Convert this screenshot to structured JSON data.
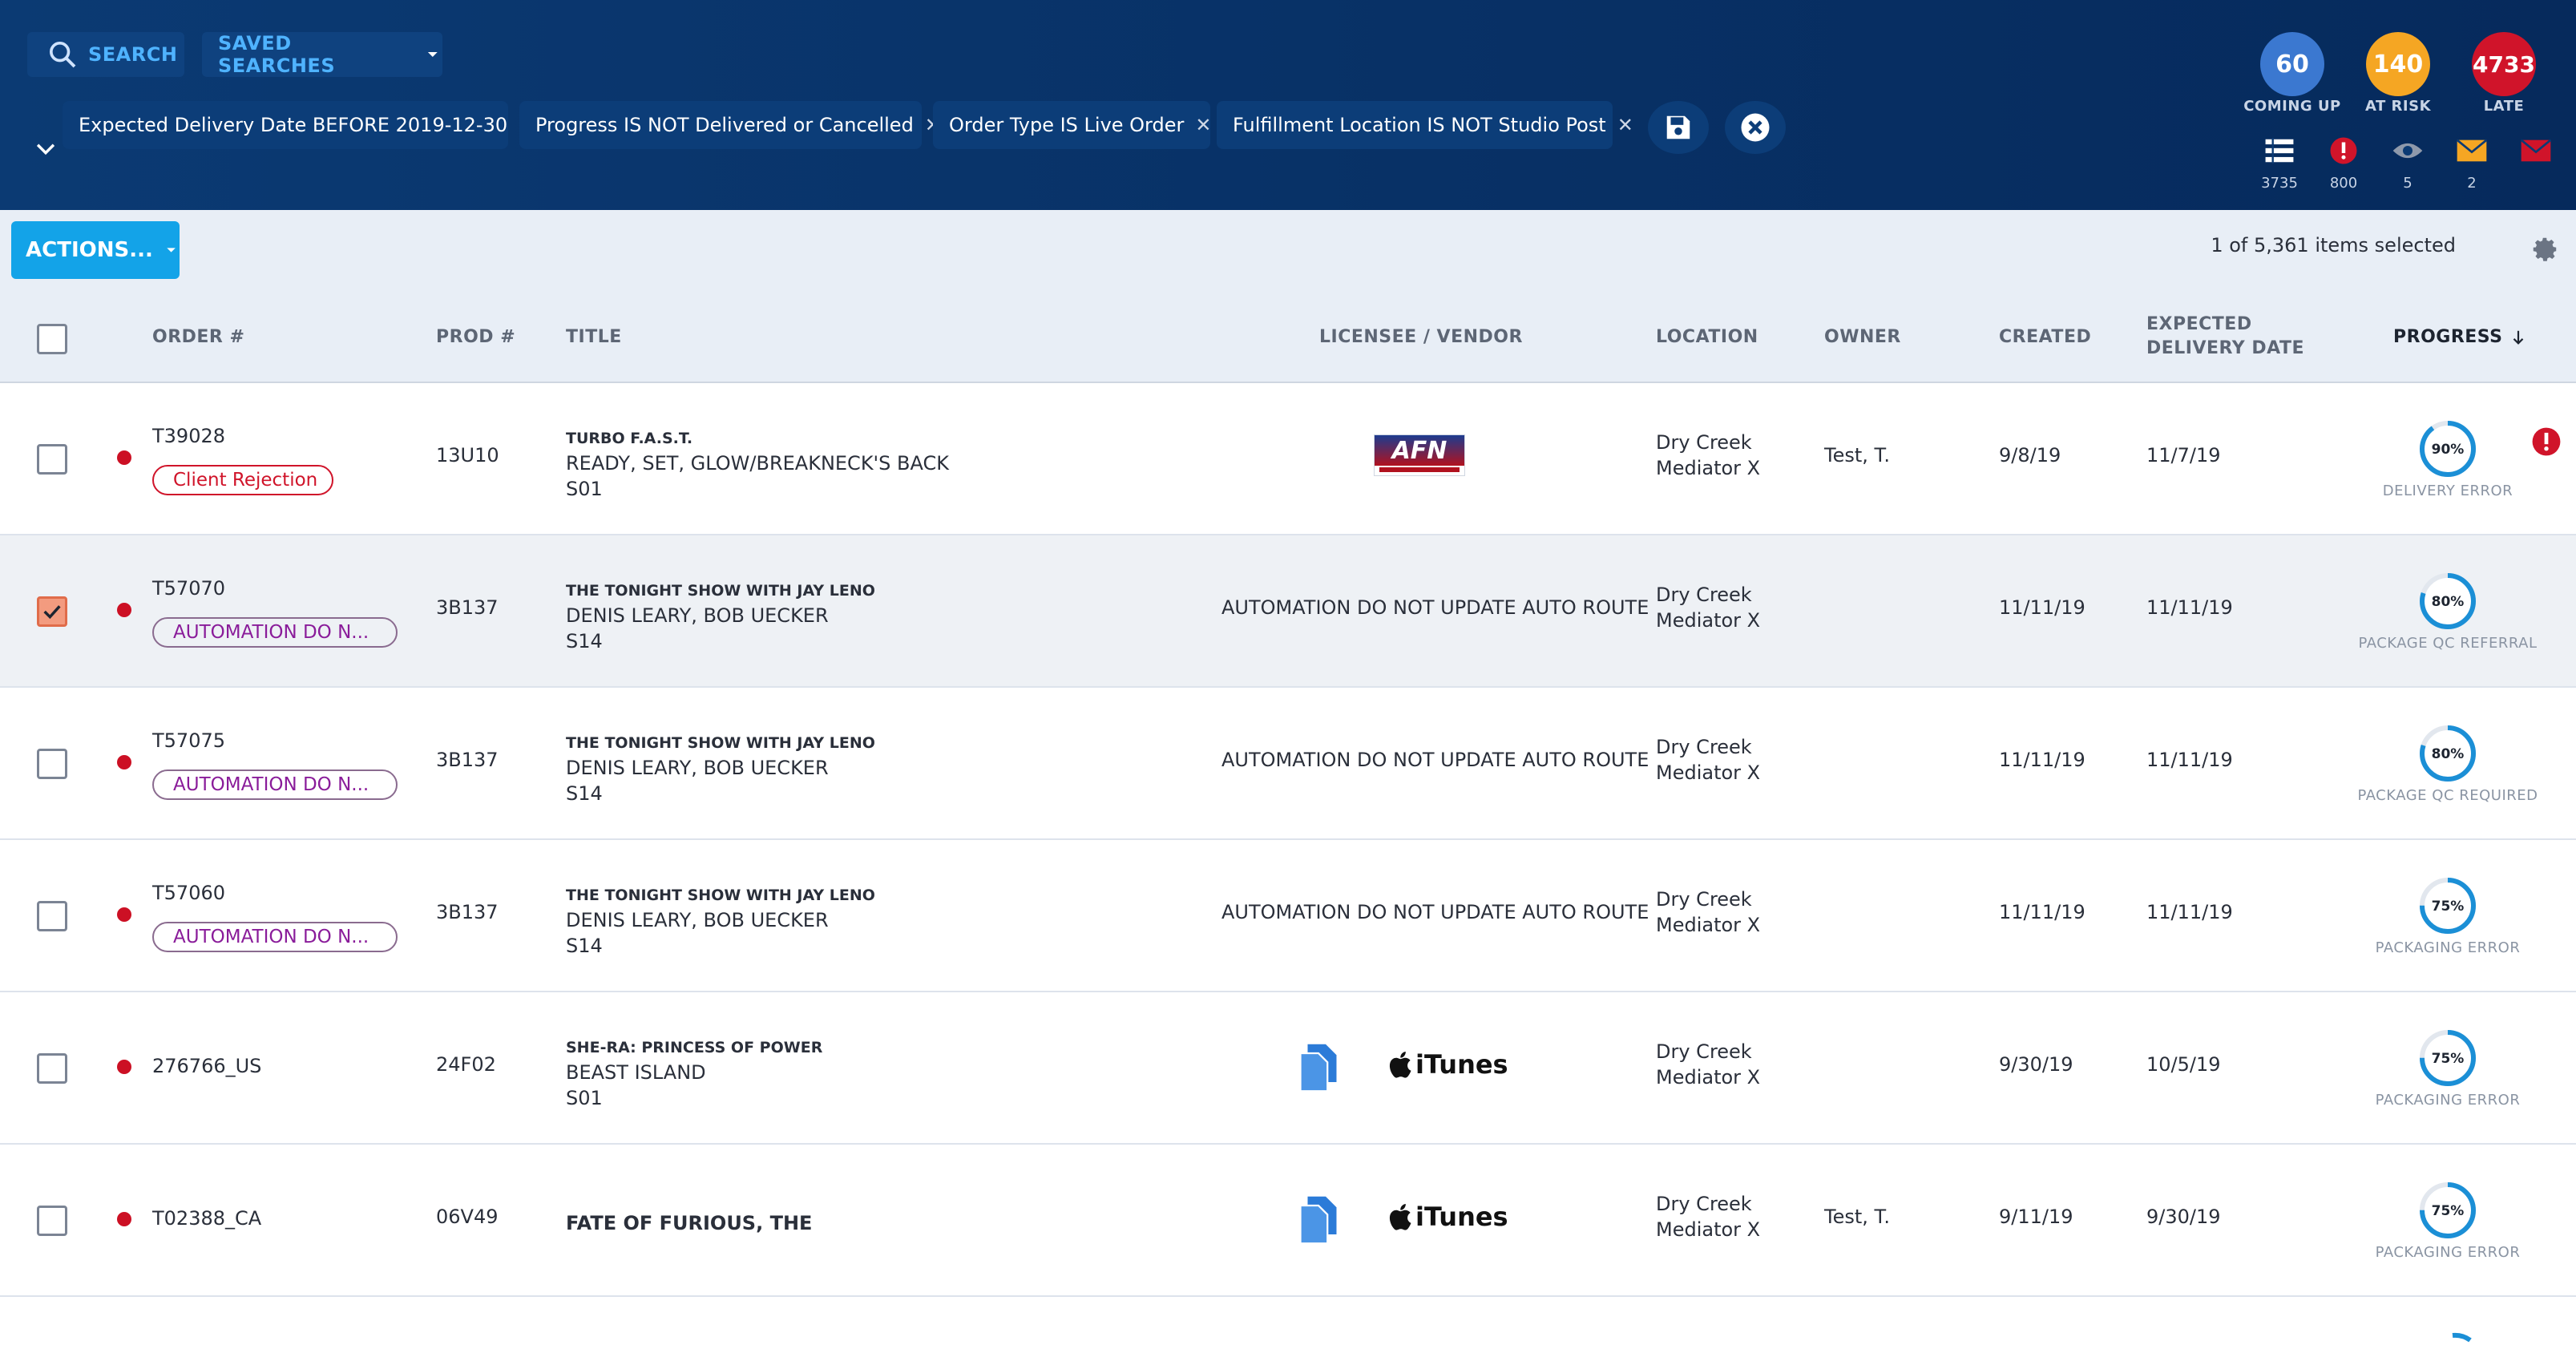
{
  "header": {
    "search_label": "SEARCH",
    "saved_searches_label": "SAVED SEARCHES",
    "filters": [
      {
        "label": "Expected Delivery Date BEFORE 2019-12-30"
      },
      {
        "label": "Progress IS NOT Delivered or Cancelled"
      },
      {
        "label": "Order Type IS Live Order"
      },
      {
        "label": "Fulfillment Location IS NOT Studio Post"
      }
    ],
    "stats": [
      {
        "value": "60",
        "label": "COMING UP",
        "color": "#3b78d0"
      },
      {
        "value": "140",
        "label": "AT RISK",
        "color": "#f5a623"
      },
      {
        "value": "4733",
        "label": "LATE",
        "color": "#d0142a"
      }
    ],
    "mini_counts": [
      {
        "icon": "list-icon",
        "count": "3735"
      },
      {
        "icon": "alert-icon",
        "count": "800"
      },
      {
        "icon": "eye-icon",
        "count": "5"
      },
      {
        "icon": "envelope-icon",
        "count": "2"
      },
      {
        "icon": "envelope-red-icon",
        "count": ""
      }
    ]
  },
  "toolbar": {
    "actions_label": "ACTIONS...",
    "selected_text": "1 of 5,361 items selected"
  },
  "columns": {
    "order": "ORDER #",
    "prod": "PROD #",
    "title": "TITLE",
    "licensee": "LICENSEE / VENDOR",
    "location": "LOCATION",
    "owner": "OWNER",
    "created": "CREATED",
    "expected_1": "EXPECTED",
    "expected_2": "DELIVERY DATE",
    "progress": "PROGRESS"
  },
  "rows": [
    {
      "order": "T39028",
      "badge": "Client Rejection",
      "badge_type": "red",
      "prod": "13U10",
      "title1": "TURBO F.A.S.T.",
      "title2": "READY, SET, GLOW/BREAKNECK'S BACK",
      "title3": "S01",
      "licensee": "",
      "licensee_logo": "AFN",
      "location1": "Dry Creek",
      "location2": "Mediator X",
      "owner": "Test, T.",
      "created": "9/8/19",
      "expected": "11/7/19",
      "progress_pct": 90,
      "progress_label": "DELIVERY ERROR",
      "alert": true,
      "checked": false
    },
    {
      "order": "T57070",
      "badge": "AUTOMATION DO N...",
      "badge_type": "purple",
      "prod": "3B137",
      "title1": "THE TONIGHT SHOW WITH JAY LENO",
      "title2": "DENIS LEARY, BOB UECKER",
      "title3": "S14",
      "licensee": "AUTOMATION DO NOT UPDATE AUTO ROUTE",
      "licensee_logo": "",
      "location1": "Dry Creek",
      "location2": "Mediator X",
      "owner": "",
      "created": "11/11/19",
      "expected": "11/11/19",
      "progress_pct": 80,
      "progress_label": "PACKAGE QC REFERRAL",
      "alert": false,
      "checked": true
    },
    {
      "order": "T57075",
      "badge": "AUTOMATION DO N...",
      "badge_type": "purple",
      "prod": "3B137",
      "title1": "THE TONIGHT SHOW WITH JAY LENO",
      "title2": "DENIS LEARY, BOB UECKER",
      "title3": "S14",
      "licensee": "AUTOMATION DO NOT UPDATE AUTO ROUTE",
      "licensee_logo": "",
      "location1": "Dry Creek",
      "location2": "Mediator X",
      "owner": "",
      "created": "11/11/19",
      "expected": "11/11/19",
      "progress_pct": 80,
      "progress_label": "PACKAGE QC REQUIRED",
      "alert": false,
      "checked": false
    },
    {
      "order": "T57060",
      "badge": "AUTOMATION DO N...",
      "badge_type": "purple",
      "prod": "3B137",
      "title1": "THE TONIGHT SHOW WITH JAY LENO",
      "title2": "DENIS LEARY, BOB UECKER",
      "title3": "S14",
      "licensee": "AUTOMATION DO NOT UPDATE AUTO ROUTE",
      "licensee_logo": "",
      "location1": "Dry Creek",
      "location2": "Mediator X",
      "owner": "",
      "created": "11/11/19",
      "expected": "11/11/19",
      "progress_pct": 75,
      "progress_label": "PACKAGING ERROR",
      "alert": false,
      "checked": false
    },
    {
      "order": "276766_US",
      "badge": "",
      "badge_type": "",
      "prod": "24F02",
      "title1": "SHE-RA: PRINCESS OF POWER",
      "title2": "BEAST ISLAND",
      "title3": "S01",
      "licensee": "",
      "licensee_logo": "iTunes",
      "location1": "Dry Creek",
      "location2": "Mediator X",
      "owner": "",
      "created": "9/30/19",
      "expected": "10/5/19",
      "progress_pct": 75,
      "progress_label": "PACKAGING ERROR",
      "alert": false,
      "checked": false
    },
    {
      "order": "T02388_CA",
      "badge": "",
      "badge_type": "",
      "prod": "06V49",
      "title1": "",
      "title2": "FATE OF FURIOUS, THE",
      "title3": "",
      "licensee": "",
      "licensee_logo": "iTunes",
      "location1": "Dry Creek",
      "location2": "Mediator X",
      "owner": "Test, T.",
      "created": "9/11/19",
      "expected": "9/30/19",
      "progress_pct": 75,
      "progress_label": "PACKAGING ERROR",
      "alert": false,
      "checked": false
    }
  ]
}
